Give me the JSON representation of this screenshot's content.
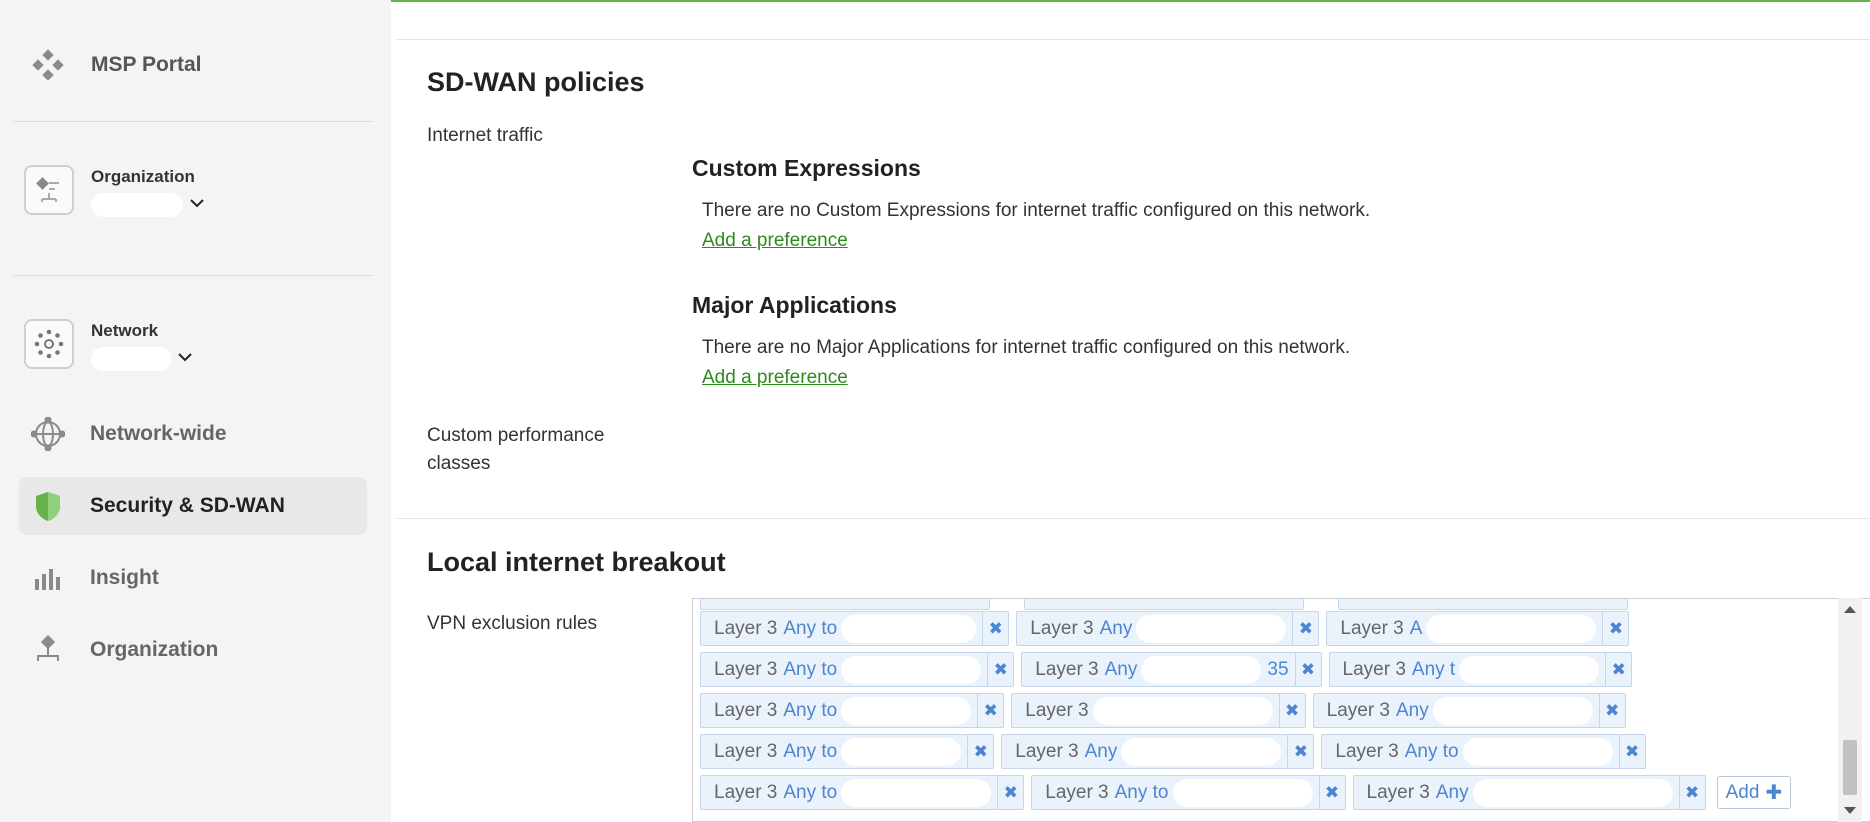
{
  "sidebar": {
    "portal_label": "MSP Portal",
    "org_scope_title": "Organization",
    "network_scope_title": "Network",
    "nav": [
      {
        "label": "Network-wide",
        "icon": "globe-icon",
        "active": false
      },
      {
        "label": "Security & SD-WAN",
        "icon": "shield-icon",
        "active": true
      },
      {
        "label": "Insight",
        "icon": "bar-chart-icon",
        "active": false
      },
      {
        "label": "Organization",
        "icon": "org-tree-icon",
        "active": false
      }
    ]
  },
  "main": {
    "accent_color": "#67b24c",
    "sdwan": {
      "title": "SD-WAN policies",
      "internet_traffic_label": "Internet traffic",
      "custom_expressions_title": "Custom Expressions",
      "custom_expressions_text": "There are no Custom Expressions for internet traffic configured on this network.",
      "custom_expressions_link": "Add a preference",
      "major_apps_title": "Major Applications",
      "major_apps_text": "There are no Major Applications for internet traffic configured on this network.",
      "major_apps_link": "Add a preference",
      "custom_perf_label_line1": "Custom performance",
      "custom_perf_label_line2": "classes"
    },
    "breakout": {
      "title": "Local internet breakout",
      "vpn_exclusion_label": "VPN exclusion rules",
      "rows": [
        [
          {
            "protocol": "Layer 3",
            "cond": "Any to",
            "tail": ""
          },
          {
            "protocol": "Layer 3",
            "cond": "Any",
            "tail": ""
          },
          {
            "protocol": "Layer 3",
            "cond": "A",
            "tail": ""
          }
        ],
        [
          {
            "protocol": "Layer 3",
            "cond": "Any to",
            "tail": ""
          },
          {
            "protocol": "Layer 3",
            "cond": "Any",
            "tail": "35"
          },
          {
            "protocol": "Layer 3",
            "cond": "Any t",
            "tail": ""
          }
        ],
        [
          {
            "protocol": "Layer 3",
            "cond": "Any to",
            "tail": ""
          },
          {
            "protocol": "Layer 3",
            "cond": "",
            "tail": ""
          },
          {
            "protocol": "Layer 3",
            "cond": "Any",
            "tail": ""
          }
        ],
        [
          {
            "protocol": "Layer 3",
            "cond": "Any to",
            "tail": ""
          },
          {
            "protocol": "Layer 3",
            "cond": "Any",
            "tail": ""
          },
          {
            "protocol": "Layer 3",
            "cond": "Any to",
            "tail": ""
          }
        ],
        [
          {
            "protocol": "Layer 3",
            "cond": "Any to",
            "tail": ""
          },
          {
            "protocol": "Layer 3",
            "cond": "Any to",
            "tail": ""
          },
          {
            "protocol": "Layer 3",
            "cond": "Any",
            "tail": ""
          }
        ]
      ],
      "add_label": "Add",
      "chip_text_color": "#4d85d1"
    }
  }
}
